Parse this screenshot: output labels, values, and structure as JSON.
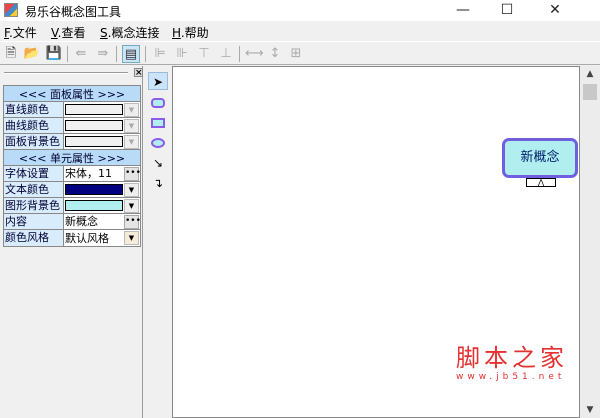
{
  "window": {
    "title": "易乐谷概念图工具",
    "minimize": "—",
    "maximize": "☐",
    "close": "✕"
  },
  "menu": [
    {
      "key": "F",
      "label": ".文件"
    },
    {
      "key": "V",
      "label": ".查看"
    },
    {
      "key": "S",
      "label": ".概念连接"
    },
    {
      "key": "H",
      "label": ".帮助"
    }
  ],
  "panel": {
    "close": "×",
    "panel_header": "<<<  面板属性  >>>",
    "panel_props": [
      {
        "label": "直线颜色",
        "color": "#f0f0f0"
      },
      {
        "label": "曲线颜色",
        "color": "#f0f0f0"
      },
      {
        "label": "面板背景色",
        "color": "#f0f0f0"
      }
    ],
    "unit_header": "<<<  单元属性  >>>",
    "font_label": "字体设置",
    "font_value": "宋体，11",
    "text_color_label": "文本颜色",
    "text_color": "#000080",
    "shape_bg_label": "图形背景色",
    "shape_bg": "#b0eef0",
    "content_label": "内容",
    "content_value": "新概念",
    "style_label": "颜色风格",
    "style_value": "默认风格"
  },
  "canvas": {
    "node_text": "新概念",
    "watermark": "脚本之家",
    "watermark_url": "www.jb51.net"
  }
}
